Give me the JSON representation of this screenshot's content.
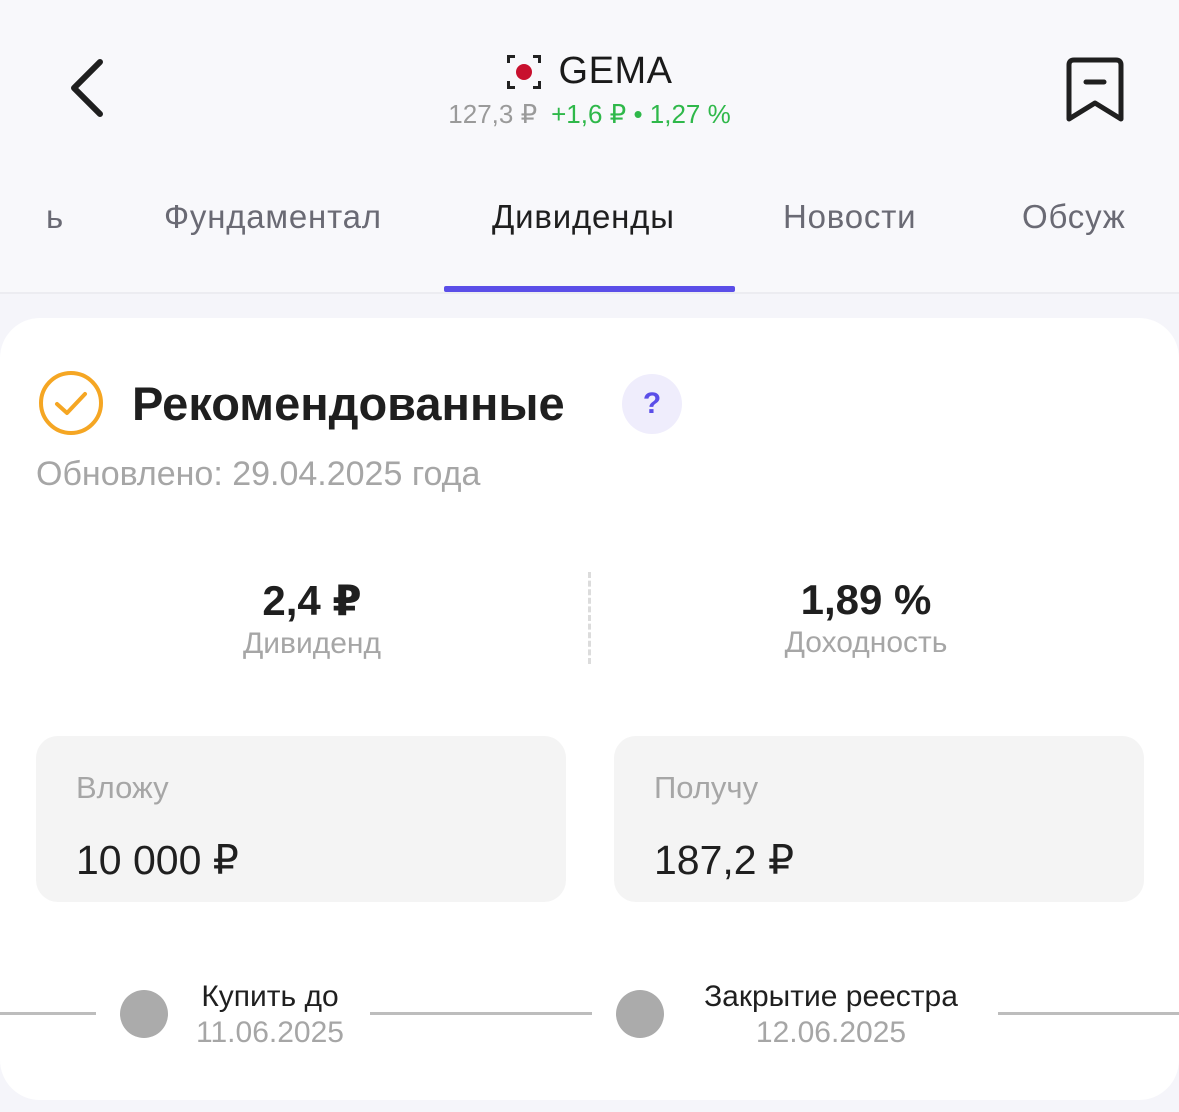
{
  "header": {
    "ticker": "GEMA",
    "price": "127,3 ₽",
    "change": "+1,6 ₽ • 1,27 %",
    "colors": {
      "positive": "#2fb84a",
      "accent": "#5b4ee8"
    }
  },
  "tabs": [
    {
      "label": "ь"
    },
    {
      "label": "Фундаментал"
    },
    {
      "label": "Дивиденды",
      "active": true
    },
    {
      "label": "Новости"
    },
    {
      "label": "Обсуж"
    }
  ],
  "dividends": {
    "title": "Рекомендованные",
    "help": "?",
    "updated": "Обновлено: 29.04.2025 года",
    "dividend": {
      "value": "2,4 ₽",
      "label": "Дивиденд"
    },
    "yield": {
      "value": "1,89 %",
      "label": "Доходность"
    },
    "invest": {
      "label": "Вложу",
      "value": "10 000 ₽"
    },
    "receive": {
      "label": "Получу",
      "value": "187,2 ₽"
    },
    "timeline": [
      {
        "title": "Купить до",
        "date": "11.06.2025"
      },
      {
        "title": "Закрытие реестра",
        "date": "12.06.2025"
      }
    ]
  }
}
